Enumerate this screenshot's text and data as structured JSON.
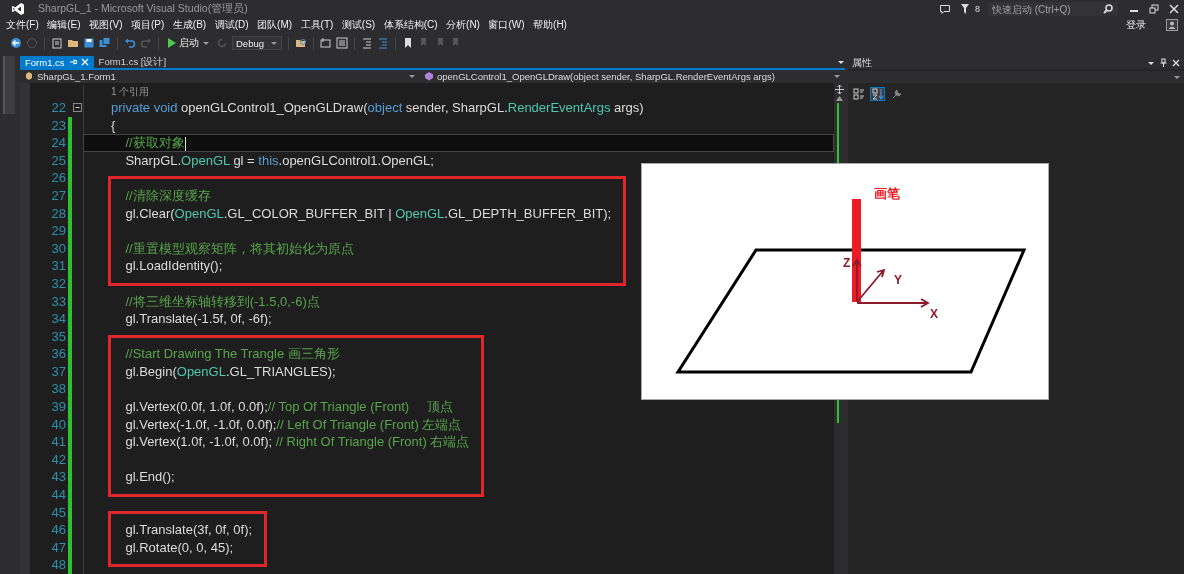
{
  "window": {
    "title": "SharpGL_1 - Microsoft Visual Studio(管理员)",
    "notification_count": "8",
    "quick_launch": {
      "placeholder": "快速启动 (Ctrl+Q)"
    },
    "sign_in": "登录"
  },
  "menu": [
    "文件(F)",
    "编辑(E)",
    "视图(V)",
    "项目(P)",
    "生成(B)",
    "调试(D)",
    "团队(M)",
    "工具(T)",
    "测试(S)",
    "体系结构(C)",
    "分析(N)",
    "窗口(W)",
    "帮助(H)"
  ],
  "toolbar": {
    "start_label": "启动",
    "configuration": "Debug"
  },
  "editor_tabs": [
    {
      "label": "Form1.cs",
      "selected": true
    },
    {
      "label": "Form1.cs [设计]",
      "selected": false
    }
  ],
  "navigation": {
    "type_dropdown": "SharpGL_1.Form1",
    "member_dropdown": "openGLControl1_OpenGLDraw(object sender, SharpGL.RenderEventArgs args)"
  },
  "code": {
    "reference_count": "1 个引用",
    "blocks": [
      {
        "boxed": false,
        "lines": [
          {
            "number": "22",
            "current": false,
            "changed": false,
            "collapsible": true,
            "tokens": [
              {
                "kind": "keyword",
                "text": "private void"
              },
              {
                "kind": "plain",
                "text": " openGLControl1_OpenGLDraw("
              },
              {
                "kind": "keyword",
                "text": "object"
              },
              {
                "kind": "plain",
                "text": " sender, SharpGL."
              },
              {
                "kind": "type",
                "text": "RenderEventArgs"
              },
              {
                "kind": "plain",
                "text": " args)"
              }
            ]
          },
          {
            "number": "23",
            "current": false,
            "changed": true,
            "collapsible": false,
            "tokens": [
              {
                "kind": "plain",
                "text": "{"
              }
            ]
          },
          {
            "number": "24",
            "current": true,
            "changed": true,
            "collapsible": false,
            "tokens": [
              {
                "kind": "comment",
                "text": "    //获取对象"
              }
            ]
          },
          {
            "number": "25",
            "current": false,
            "changed": true,
            "collapsible": false,
            "tokens": [
              {
                "kind": "plain",
                "text": "    SharpGL."
              },
              {
                "kind": "type",
                "text": "OpenGL"
              },
              {
                "kind": "plain",
                "text": " gl = "
              },
              {
                "kind": "keyword",
                "text": "this"
              },
              {
                "kind": "plain",
                "text": ".openGLControl1.OpenGL;"
              }
            ]
          }
        ]
      },
      {
        "boxed": true,
        "lines": [
          {
            "number": "26",
            "current": false,
            "changed": true,
            "collapsible": false
          },
          {
            "number": "27",
            "current": false,
            "changed": true,
            "collapsible": false,
            "tokens": [
              {
                "kind": "comment",
                "text": "    //清除深度缓存"
              }
            ]
          },
          {
            "number": "28",
            "current": false,
            "changed": true,
            "collapsible": false,
            "tokens": [
              {
                "kind": "plain",
                "text": "    gl.Clear("
              },
              {
                "kind": "type",
                "text": "OpenGL"
              },
              {
                "kind": "plain",
                "text": ".GL_COLOR_BUFFER_BIT | "
              },
              {
                "kind": "type",
                "text": "OpenGL"
              },
              {
                "kind": "plain",
                "text": ".GL_DEPTH_BUFFER_BIT);"
              }
            ]
          },
          {
            "number": "29",
            "current": false,
            "changed": true,
            "collapsible": false
          },
          {
            "number": "30",
            "current": false,
            "changed": true,
            "collapsible": false,
            "tokens": [
              {
                "kind": "comment",
                "text": "    //重置模型观察矩阵，将其初始化为原点"
              }
            ]
          },
          {
            "number": "31",
            "current": false,
            "changed": true,
            "collapsible": false,
            "tokens": [
              {
                "kind": "plain",
                "text": "    gl.LoadIdentity();"
              }
            ]
          },
          {
            "number": "32",
            "current": false,
            "changed": true,
            "collapsible": false
          }
        ]
      },
      {
        "boxed": false,
        "lines": [
          {
            "number": "33",
            "current": false,
            "changed": true,
            "collapsible": false,
            "tokens": [
              {
                "kind": "comment",
                "text": "    //将三维坐标轴转移到(-1.5,0,-6)点"
              }
            ]
          },
          {
            "number": "34",
            "current": false,
            "changed": true,
            "collapsible": false,
            "tokens": [
              {
                "kind": "plain",
                "text": "    gl.Translate(-1.5f, 0f, -6f);"
              }
            ]
          }
        ]
      },
      {
        "boxed": true,
        "lines": [
          {
            "number": "35",
            "current": false,
            "changed": true,
            "collapsible": false
          },
          {
            "number": "36",
            "current": false,
            "changed": true,
            "collapsible": false,
            "tokens": [
              {
                "kind": "comment",
                "text": "    //Start Drawing The Trangle 画三角形"
              }
            ]
          },
          {
            "number": "37",
            "current": false,
            "changed": true,
            "collapsible": false,
            "tokens": [
              {
                "kind": "plain",
                "text": "    gl.Begin("
              },
              {
                "kind": "type",
                "text": "OpenGL"
              },
              {
                "kind": "plain",
                "text": ".GL_TRIANGLES);"
              }
            ]
          },
          {
            "number": "38",
            "current": false,
            "changed": true,
            "collapsible": false
          },
          {
            "number": "39",
            "current": false,
            "changed": true,
            "collapsible": false,
            "tokens": [
              {
                "kind": "plain",
                "text": "    gl.Vertex(0.0f, 1.0f, 0.0f);"
              },
              {
                "kind": "comment",
                "text": "// Top Of Triangle (Front)     顶点"
              }
            ]
          },
          {
            "number": "40",
            "current": false,
            "changed": true,
            "collapsible": false,
            "tokens": [
              {
                "kind": "plain",
                "text": "    gl.Vertex(-1.0f, -1.0f, 0.0f);"
              },
              {
                "kind": "comment",
                "text": "// Left Of Triangle (Front) 左端点"
              }
            ]
          },
          {
            "number": "41",
            "current": false,
            "changed": true,
            "collapsible": false,
            "tokens": [
              {
                "kind": "plain",
                "text": "    gl.Vertex(1.0f, -1.0f, 0.0f); "
              },
              {
                "kind": "comment",
                "text": "// Right Of Triangle (Front) 右端点"
              }
            ]
          },
          {
            "number": "42",
            "current": false,
            "changed": true,
            "collapsible": false
          },
          {
            "number": "43",
            "current": false,
            "changed": true,
            "collapsible": false,
            "tokens": [
              {
                "kind": "plain",
                "text": "    gl.End();"
              }
            ]
          },
          {
            "number": "44",
            "current": false,
            "changed": true,
            "collapsible": false
          }
        ]
      },
      {
        "boxed": true,
        "lines": [
          {
            "number": "45",
            "current": false,
            "changed": true,
            "collapsible": false
          },
          {
            "number": "46",
            "current": false,
            "changed": true,
            "collapsible": false,
            "tokens": [
              {
                "kind": "plain",
                "text": "    gl.Translate(3f, 0f, 0f);"
              }
            ]
          },
          {
            "number": "47",
            "current": false,
            "changed": true,
            "collapsible": false,
            "tokens": [
              {
                "kind": "plain",
                "text": "    gl.Rotate(0, 0, 45);"
              }
            ]
          },
          {
            "number": "48",
            "current": false,
            "changed": true,
            "collapsible": false
          }
        ]
      }
    ]
  },
  "diagram": {
    "pen_label": "画笔",
    "axes": [
      {
        "label": "Z",
        "kind": "z"
      },
      {
        "label": "Y",
        "kind": "y"
      },
      {
        "label": "X",
        "kind": "x"
      }
    ]
  },
  "properties_panel": {
    "title": "属性",
    "tools": [
      {
        "kind": "categorized",
        "selected": false
      },
      {
        "kind": "alphabetical",
        "selected": true
      },
      {
        "kind": "property-pages",
        "selected": false
      }
    ]
  }
}
